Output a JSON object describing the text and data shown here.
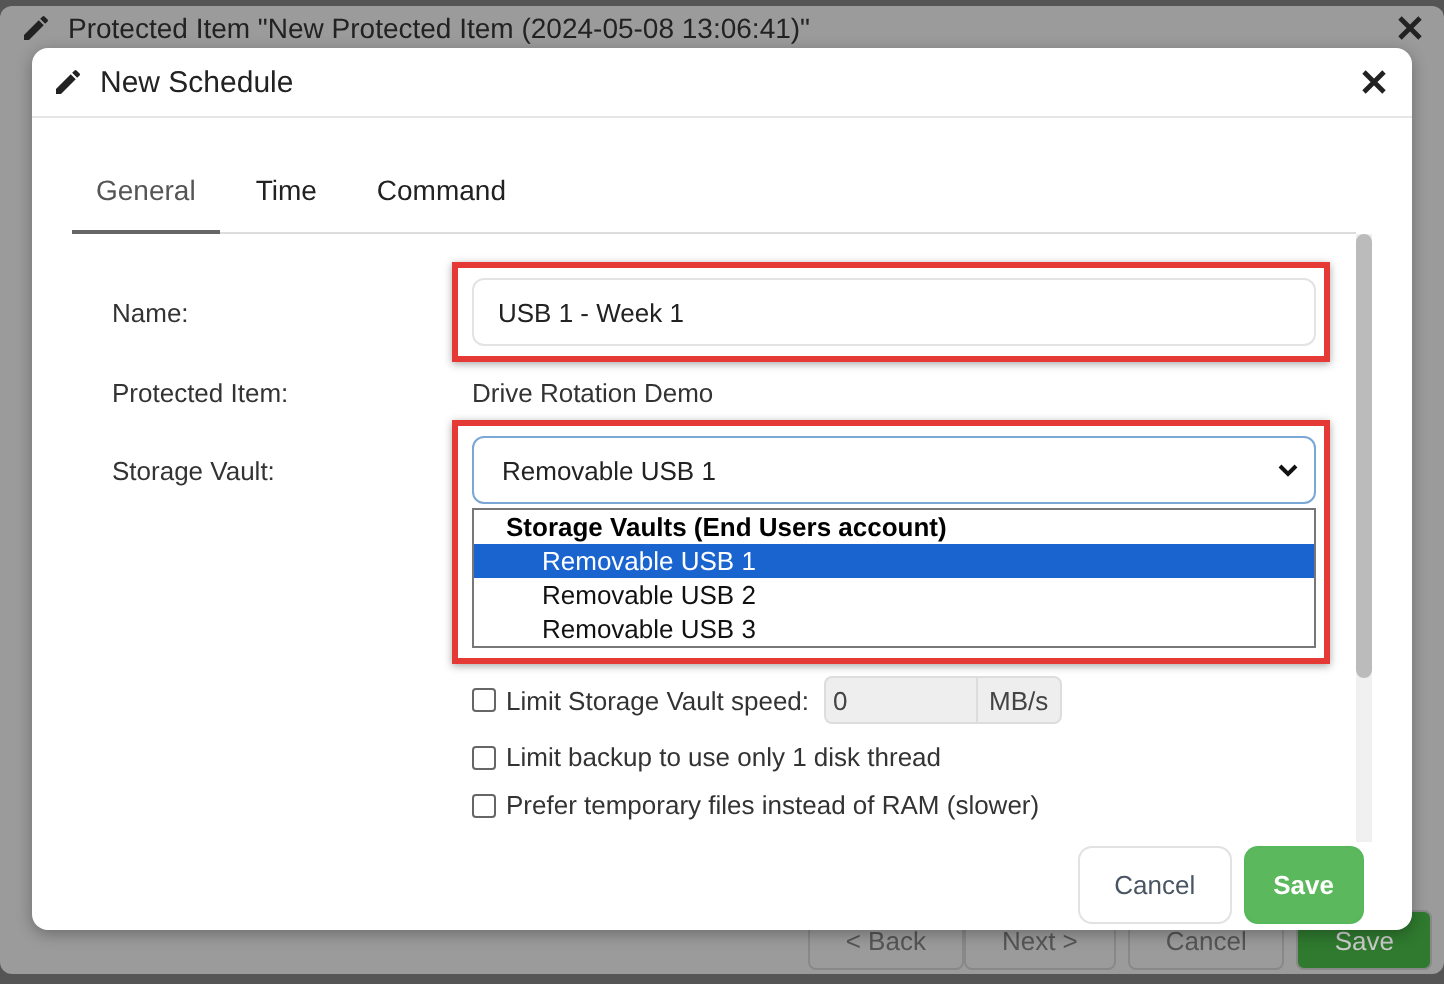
{
  "background_window": {
    "title": "Protected Item \"New Protected Item (2024-05-08 13:06:41)\"",
    "buttons": [
      {
        "label": "< Back",
        "kind": "default"
      },
      {
        "label": "Next >",
        "kind": "default"
      },
      {
        "label": "Cancel",
        "kind": "default"
      },
      {
        "label": "Save",
        "kind": "primary"
      }
    ]
  },
  "dialog": {
    "title": "New Schedule",
    "tabs": [
      {
        "label": "General",
        "selected": true
      },
      {
        "label": "Time",
        "selected": false
      },
      {
        "label": "Command",
        "selected": false
      }
    ],
    "name": {
      "label": "Name:",
      "value": "USB 1 - Week 1",
      "highlighted": true
    },
    "protected_item": {
      "label": "Protected Item:",
      "value": "Drive Rotation Demo"
    },
    "storage_vault": {
      "label": "Storage Vault:",
      "value": "Removable USB 1",
      "highlighted": true,
      "expanded": true,
      "group": "Storage Vaults (End Users account)",
      "options": [
        {
          "label": "Removable USB 1",
          "selected": true
        },
        {
          "label": "Removable USB 2",
          "selected": false
        },
        {
          "label": "Removable USB 3",
          "selected": false
        }
      ]
    },
    "options": [
      {
        "kind": "speed",
        "label": "Limit Storage Vault speed:",
        "checked": false,
        "value": "0",
        "unit": "MB/s"
      },
      {
        "kind": "plain",
        "label": "Limit backup to use only 1 disk thread",
        "checked": false
      },
      {
        "kind": "plain",
        "label": "Prefer temporary files instead of RAM (slower)",
        "checked": false
      }
    ],
    "buttons": [
      {
        "label": "Cancel",
        "kind": "default"
      },
      {
        "label": "Save",
        "kind": "primary"
      }
    ]
  }
}
